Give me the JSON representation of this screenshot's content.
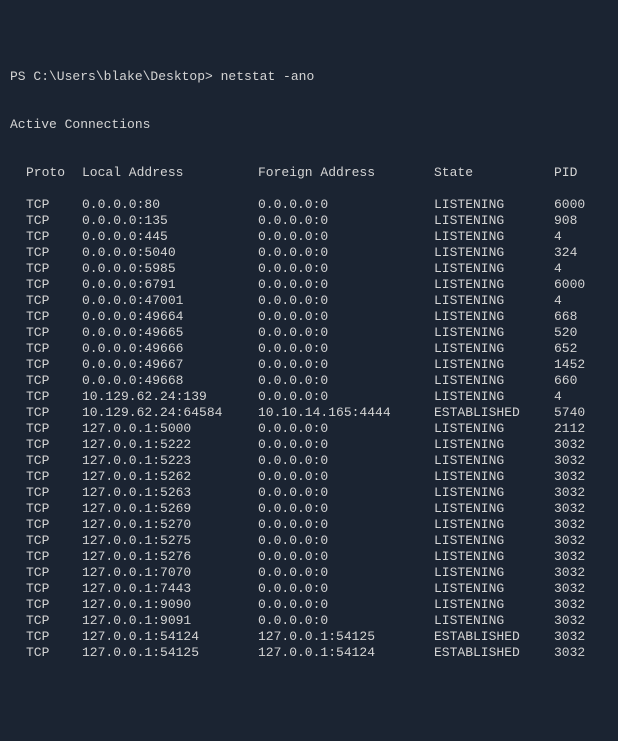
{
  "prompt": "PS C:\\Users\\blake\\Desktop> netstat -ano",
  "header": "Active Connections",
  "columns": {
    "proto": "Proto",
    "local": "Local Address",
    "foreign": "Foreign Address",
    "state": "State",
    "pid": "PID"
  },
  "rows": [
    {
      "proto": "TCP",
      "local": "0.0.0.0:80",
      "foreign": "0.0.0.0:0",
      "state": "LISTENING",
      "pid": "6000"
    },
    {
      "proto": "TCP",
      "local": "0.0.0.0:135",
      "foreign": "0.0.0.0:0",
      "state": "LISTENING",
      "pid": "908"
    },
    {
      "proto": "TCP",
      "local": "0.0.0.0:445",
      "foreign": "0.0.0.0:0",
      "state": "LISTENING",
      "pid": "4"
    },
    {
      "proto": "TCP",
      "local": "0.0.0.0:5040",
      "foreign": "0.0.0.0:0",
      "state": "LISTENING",
      "pid": "324"
    },
    {
      "proto": "TCP",
      "local": "0.0.0.0:5985",
      "foreign": "0.0.0.0:0",
      "state": "LISTENING",
      "pid": "4"
    },
    {
      "proto": "TCP",
      "local": "0.0.0.0:6791",
      "foreign": "0.0.0.0:0",
      "state": "LISTENING",
      "pid": "6000"
    },
    {
      "proto": "TCP",
      "local": "0.0.0.0:47001",
      "foreign": "0.0.0.0:0",
      "state": "LISTENING",
      "pid": "4"
    },
    {
      "proto": "TCP",
      "local": "0.0.0.0:49664",
      "foreign": "0.0.0.0:0",
      "state": "LISTENING",
      "pid": "668"
    },
    {
      "proto": "TCP",
      "local": "0.0.0.0:49665",
      "foreign": "0.0.0.0:0",
      "state": "LISTENING",
      "pid": "520"
    },
    {
      "proto": "TCP",
      "local": "0.0.0.0:49666",
      "foreign": "0.0.0.0:0",
      "state": "LISTENING",
      "pid": "652"
    },
    {
      "proto": "TCP",
      "local": "0.0.0.0:49667",
      "foreign": "0.0.0.0:0",
      "state": "LISTENING",
      "pid": "1452"
    },
    {
      "proto": "TCP",
      "local": "0.0.0.0:49668",
      "foreign": "0.0.0.0:0",
      "state": "LISTENING",
      "pid": "660"
    },
    {
      "proto": "TCP",
      "local": "10.129.62.24:139",
      "foreign": "0.0.0.0:0",
      "state": "LISTENING",
      "pid": "4"
    },
    {
      "proto": "TCP",
      "local": "10.129.62.24:64584",
      "foreign": "10.10.14.165:4444",
      "state": "ESTABLISHED",
      "pid": "5740"
    },
    {
      "proto": "TCP",
      "local": "127.0.0.1:5000",
      "foreign": "0.0.0.0:0",
      "state": "LISTENING",
      "pid": "2112"
    },
    {
      "proto": "TCP",
      "local": "127.0.0.1:5222",
      "foreign": "0.0.0.0:0",
      "state": "LISTENING",
      "pid": "3032"
    },
    {
      "proto": "TCP",
      "local": "127.0.0.1:5223",
      "foreign": "0.0.0.0:0",
      "state": "LISTENING",
      "pid": "3032"
    },
    {
      "proto": "TCP",
      "local": "127.0.0.1:5262",
      "foreign": "0.0.0.0:0",
      "state": "LISTENING",
      "pid": "3032"
    },
    {
      "proto": "TCP",
      "local": "127.0.0.1:5263",
      "foreign": "0.0.0.0:0",
      "state": "LISTENING",
      "pid": "3032"
    },
    {
      "proto": "TCP",
      "local": "127.0.0.1:5269",
      "foreign": "0.0.0.0:0",
      "state": "LISTENING",
      "pid": "3032"
    },
    {
      "proto": "TCP",
      "local": "127.0.0.1:5270",
      "foreign": "0.0.0.0:0",
      "state": "LISTENING",
      "pid": "3032"
    },
    {
      "proto": "TCP",
      "local": "127.0.0.1:5275",
      "foreign": "0.0.0.0:0",
      "state": "LISTENING",
      "pid": "3032"
    },
    {
      "proto": "TCP",
      "local": "127.0.0.1:5276",
      "foreign": "0.0.0.0:0",
      "state": "LISTENING",
      "pid": "3032"
    },
    {
      "proto": "TCP",
      "local": "127.0.0.1:7070",
      "foreign": "0.0.0.0:0",
      "state": "LISTENING",
      "pid": "3032"
    },
    {
      "proto": "TCP",
      "local": "127.0.0.1:7443",
      "foreign": "0.0.0.0:0",
      "state": "LISTENING",
      "pid": "3032"
    },
    {
      "proto": "TCP",
      "local": "127.0.0.1:9090",
      "foreign": "0.0.0.0:0",
      "state": "LISTENING",
      "pid": "3032"
    },
    {
      "proto": "TCP",
      "local": "127.0.0.1:9091",
      "foreign": "0.0.0.0:0",
      "state": "LISTENING",
      "pid": "3032"
    },
    {
      "proto": "TCP",
      "local": "127.0.0.1:54124",
      "foreign": "127.0.0.1:54125",
      "state": "ESTABLISHED",
      "pid": "3032"
    },
    {
      "proto": "TCP",
      "local": "127.0.0.1:54125",
      "foreign": "127.0.0.1:54124",
      "state": "ESTABLISHED",
      "pid": "3032"
    }
  ]
}
